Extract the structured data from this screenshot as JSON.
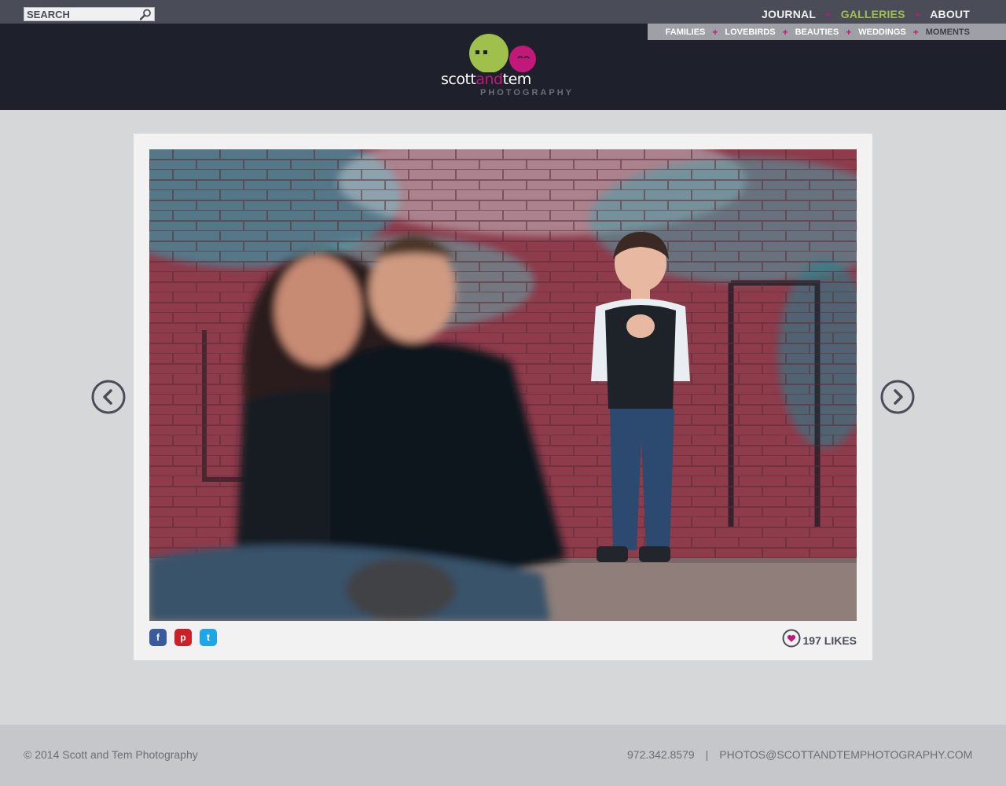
{
  "search": {
    "placeholder": "SEARCH"
  },
  "main_nav": {
    "items": [
      {
        "label": "JOURNAL",
        "active": false
      },
      {
        "label": "GALLERIES",
        "active": true
      },
      {
        "label": "ABOUT",
        "active": false
      }
    ],
    "separator": "+"
  },
  "sub_nav": {
    "items": [
      {
        "label": "FAMILIES"
      },
      {
        "label": "LOVEBIRDS"
      },
      {
        "label": "BEAUTIES"
      },
      {
        "label": "WEDDINGS"
      },
      {
        "label": "MOMENTS",
        "current": true
      }
    ],
    "separator": "+"
  },
  "logo": {
    "word_part1": "scott",
    "word_part2": "and",
    "word_part3": "tem",
    "subtitle": "PHOTOGRAPHY"
  },
  "gallery": {
    "photo_icon": "photo-couple-kissing-boy-graffiti",
    "prev_icon": "chevron-left-circle-icon",
    "next_icon": "chevron-right-circle-icon",
    "share_icons": [
      "facebook-icon",
      "pinterest-icon",
      "twitter-icon"
    ],
    "likes_count": "197",
    "likes_label": "LIKES"
  },
  "footer": {
    "copyright": "© 2014 Scott and Tem Photography",
    "phone": "972.342.8579",
    "separator": "|",
    "email": "PHOTOS@SCOTTANDTEMPHOTOGRAPHY.COM"
  },
  "colors": {
    "topbar": "#4a4d57",
    "header": "#1e212b",
    "accent_green": "#9fc04b",
    "accent_pink": "#c1187a",
    "page_bg": "#d6d7d9"
  }
}
